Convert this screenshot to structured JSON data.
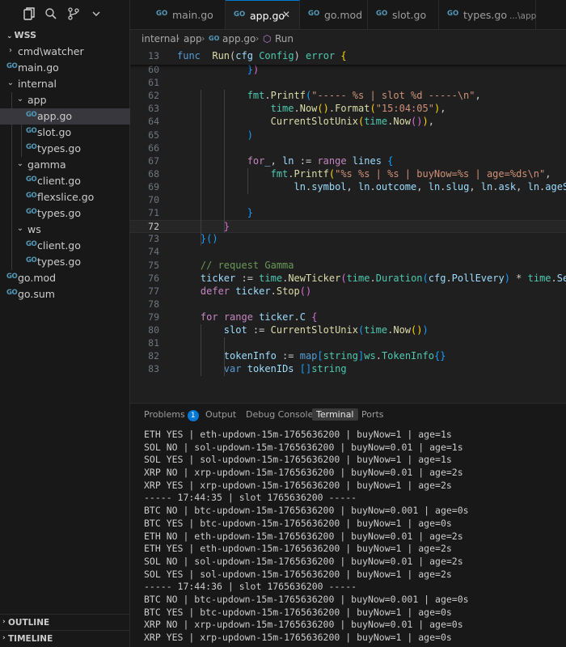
{
  "sidebar": {
    "toolbar_icons": [
      "files-icon",
      "search-icon",
      "source-control-icon",
      "chevron-down-icon"
    ],
    "explorer_title": "WSS",
    "tree": [
      {
        "label": "cmd\\watcher",
        "kind": "folder",
        "depth": 0,
        "expanded": false
      },
      {
        "label": "main.go",
        "kind": "file",
        "depth": 0
      },
      {
        "label": "internal",
        "kind": "folder",
        "depth": 0,
        "expanded": true
      },
      {
        "label": "app",
        "kind": "folder",
        "depth": 1,
        "expanded": true
      },
      {
        "label": "app.go",
        "kind": "file",
        "depth": 2,
        "selected": true
      },
      {
        "label": "slot.go",
        "kind": "file",
        "depth": 2
      },
      {
        "label": "types.go",
        "kind": "file",
        "depth": 2
      },
      {
        "label": "gamma",
        "kind": "folder",
        "depth": 1,
        "expanded": true
      },
      {
        "label": "client.go",
        "kind": "file",
        "depth": 2
      },
      {
        "label": "flexslice.go",
        "kind": "file",
        "depth": 2
      },
      {
        "label": "types.go",
        "kind": "file",
        "depth": 2
      },
      {
        "label": "ws",
        "kind": "folder",
        "depth": 1,
        "expanded": true
      },
      {
        "label": "client.go",
        "kind": "file",
        "depth": 2
      },
      {
        "label": "types.go",
        "kind": "file",
        "depth": 2
      },
      {
        "label": "go.mod",
        "kind": "file",
        "depth": 0
      },
      {
        "label": "go.sum",
        "kind": "file",
        "depth": 0
      }
    ],
    "outline_label": "OUTLINE",
    "timeline_label": "TIMELINE"
  },
  "tabs": [
    {
      "name": "main.go",
      "desc": "",
      "active": false
    },
    {
      "name": "app.go",
      "desc": "",
      "active": true
    },
    {
      "name": "go.mod",
      "desc": "",
      "active": false
    },
    {
      "name": "slot.go",
      "desc": "",
      "active": false
    },
    {
      "name": "types.go",
      "desc": "...\\app",
      "active": false
    }
  ],
  "breadcrumb": {
    "parts": [
      "internal",
      "app",
      "app.go",
      "Run"
    ]
  },
  "editor": {
    "sticky": {
      "line": "13",
      "tokens": [
        [
          "kw",
          "func"
        ],
        [
          "",
          "  "
        ],
        [
          "fn",
          "Run"
        ],
        [
          "",
          "("
        ],
        [
          "vr",
          "cfg"
        ],
        [
          "",
          " "
        ],
        [
          "ty",
          "Config"
        ],
        [
          "",
          ")"
        ],
        [
          "",
          " "
        ],
        [
          "ty",
          "error"
        ],
        [
          "",
          " "
        ],
        [
          "br1",
          "{"
        ]
      ]
    },
    "lines": [
      {
        "n": "60",
        "tokens": [
          [
            "",
            "            "
          ],
          [
            "br3",
            "}"
          ],
          [
            "br2",
            ")"
          ]
        ]
      },
      {
        "n": "61",
        "tokens": []
      },
      {
        "n": "62",
        "tokens": [
          [
            "",
            "            "
          ],
          [
            "ty",
            "fmt"
          ],
          [
            "",
            "."
          ],
          [
            "fn",
            "Printf"
          ],
          [
            "br3",
            "("
          ],
          [
            "str",
            "\"----- %s | slot %d -----\\n\""
          ],
          [
            "",
            ","
          ]
        ]
      },
      {
        "n": "63",
        "tokens": [
          [
            "",
            "                "
          ],
          [
            "ty",
            "time"
          ],
          [
            "",
            "."
          ],
          [
            "fn",
            "Now"
          ],
          [
            "br1",
            "()"
          ],
          [
            "",
            "."
          ],
          [
            "fn",
            "Format"
          ],
          [
            "br1",
            "("
          ],
          [
            "str",
            "\"15:04:05\""
          ],
          [
            "br1",
            ")"
          ],
          [
            "",
            ","
          ]
        ]
      },
      {
        "n": "64",
        "tokens": [
          [
            "",
            "                "
          ],
          [
            "fn",
            "CurrentSlotUnix"
          ],
          [
            "br1",
            "("
          ],
          [
            "ty",
            "time"
          ],
          [
            "",
            "."
          ],
          [
            "fn",
            "Now"
          ],
          [
            "br2",
            "()"
          ],
          [
            "br1",
            ")"
          ],
          [
            "",
            ","
          ]
        ]
      },
      {
        "n": "65",
        "tokens": [
          [
            "",
            "            "
          ],
          [
            "br3",
            ")"
          ]
        ]
      },
      {
        "n": "66",
        "tokens": []
      },
      {
        "n": "67",
        "tokens": [
          [
            "",
            "            "
          ],
          [
            "ctl",
            "for"
          ],
          [
            "",
            "",
            " "
          ],
          [
            "vr",
            "_"
          ],
          [
            "",
            ", "
          ],
          [
            "vr",
            "ln"
          ],
          [
            "",
            " := "
          ],
          [
            "ctl",
            "range"
          ],
          [
            "",
            " "
          ],
          [
            "vr",
            "lines"
          ],
          [
            "",
            " "
          ],
          [
            "br3",
            "{"
          ]
        ]
      },
      {
        "n": "68",
        "tokens": [
          [
            "",
            "                "
          ],
          [
            "ty",
            "fmt"
          ],
          [
            "",
            "."
          ],
          [
            "fn",
            "Printf"
          ],
          [
            "br1",
            "("
          ],
          [
            "str",
            "\"%s %s | %s | buyNow=%s | age=%ds\\n\""
          ],
          [
            "",
            ","
          ]
        ]
      },
      {
        "n": "69",
        "tokens": [
          [
            "",
            "                    "
          ],
          [
            "vr",
            "ln"
          ],
          [
            "",
            "."
          ],
          [
            "vr",
            "symbol"
          ],
          [
            "",
            ", "
          ],
          [
            "vr",
            "ln"
          ],
          [
            "",
            "."
          ],
          [
            "vr",
            "outcome"
          ],
          [
            "",
            ", "
          ],
          [
            "vr",
            "ln"
          ],
          [
            "",
            "."
          ],
          [
            "vr",
            "slug"
          ],
          [
            "",
            ", "
          ],
          [
            "vr",
            "ln"
          ],
          [
            "",
            "."
          ],
          [
            "vr",
            "ask"
          ],
          [
            "",
            ", "
          ],
          [
            "vr",
            "ln"
          ],
          [
            "",
            "."
          ],
          [
            "vr",
            "ageS"
          ],
          [
            "br1",
            ")"
          ]
        ]
      },
      {
        "n": "70",
        "tokens": []
      },
      {
        "n": "71",
        "tokens": [
          [
            "",
            "            "
          ],
          [
            "br3",
            "}"
          ]
        ]
      },
      {
        "n": "72",
        "tokens": [
          [
            "",
            "        "
          ],
          [
            "br2",
            "}"
          ]
        ],
        "current": true
      },
      {
        "n": "73",
        "tokens": [
          [
            "",
            "    "
          ],
          [
            "br3",
            "}"
          ],
          [
            "br3",
            "()"
          ]
        ]
      },
      {
        "n": "74",
        "tokens": []
      },
      {
        "n": "75",
        "tokens": [
          [
            "",
            "    "
          ],
          [
            "cm",
            "// request Gamma"
          ]
        ]
      },
      {
        "n": "76",
        "tokens": [
          [
            "",
            "    "
          ],
          [
            "vr",
            "ticker"
          ],
          [
            "",
            " := "
          ],
          [
            "ty",
            "time"
          ],
          [
            "",
            "."
          ],
          [
            "fn",
            "NewTicker"
          ],
          [
            "br2",
            "("
          ],
          [
            "ty",
            "time"
          ],
          [
            "",
            "."
          ],
          [
            "ty",
            "Duration"
          ],
          [
            "br3",
            "("
          ],
          [
            "vr",
            "cfg"
          ],
          [
            "",
            "."
          ],
          [
            "vr",
            "PollEvery"
          ],
          [
            "br3",
            ")"
          ],
          [
            "",
            " * "
          ],
          [
            "ty",
            "time"
          ],
          [
            "",
            "."
          ],
          [
            "vr",
            "Second"
          ],
          [
            "br2",
            ")"
          ]
        ]
      },
      {
        "n": "77",
        "tokens": [
          [
            "",
            "    "
          ],
          [
            "ctl",
            "defer"
          ],
          [
            "",
            " "
          ],
          [
            "vr",
            "ticker"
          ],
          [
            "",
            "."
          ],
          [
            "fn",
            "Stop"
          ],
          [
            "br2",
            "()"
          ]
        ]
      },
      {
        "n": "78",
        "tokens": []
      },
      {
        "n": "79",
        "tokens": [
          [
            "",
            "    "
          ],
          [
            "ctl",
            "for"
          ],
          [
            "",
            " "
          ],
          [
            "ctl",
            "range"
          ],
          [
            "",
            " "
          ],
          [
            "vr",
            "ticker"
          ],
          [
            "",
            "."
          ],
          [
            "vr",
            "C"
          ],
          [
            "",
            " "
          ],
          [
            "br2",
            "{"
          ]
        ]
      },
      {
        "n": "80",
        "tokens": [
          [
            "",
            "        "
          ],
          [
            "vr",
            "slot"
          ],
          [
            "",
            " := "
          ],
          [
            "fn",
            "CurrentSlotUnix"
          ],
          [
            "br3",
            "("
          ],
          [
            "ty",
            "time"
          ],
          [
            "",
            "."
          ],
          [
            "fn",
            "Now"
          ],
          [
            "br1",
            "()"
          ],
          [
            "br3",
            ")"
          ]
        ]
      },
      {
        "n": "81",
        "tokens": []
      },
      {
        "n": "82",
        "tokens": [
          [
            "",
            "        "
          ],
          [
            "vr",
            "tokenInfo"
          ],
          [
            "",
            " := "
          ],
          [
            "kw",
            "map"
          ],
          [
            "br3",
            "["
          ],
          [
            "ty",
            "string"
          ],
          [
            "br3",
            "]"
          ],
          [
            "ty",
            "ws"
          ],
          [
            "",
            "."
          ],
          [
            "ty",
            "TokenInfo"
          ],
          [
            "br3",
            "{}"
          ]
        ]
      },
      {
        "n": "83",
        "tokens": [
          [
            "",
            "        "
          ],
          [
            "kw",
            "var"
          ],
          [
            "",
            " "
          ],
          [
            "vr",
            "tokenIDs"
          ],
          [
            "",
            " "
          ],
          [
            "br3",
            "[]"
          ],
          [
            "ty",
            "string"
          ]
        ]
      }
    ]
  },
  "panel": {
    "tabs": [
      {
        "label": "Problems",
        "badge": "1",
        "active": false
      },
      {
        "label": "Output",
        "badge": "",
        "active": false
      },
      {
        "label": "Debug Console",
        "badge": "",
        "active": false
      },
      {
        "label": "Terminal",
        "badge": "",
        "active": true
      },
      {
        "label": "Ports",
        "badge": "",
        "active": false
      }
    ],
    "terminal_lines": [
      "ETH YES | eth-updown-15m-1765636200 | buyNow=1 | age=1s",
      "SOL NO | sol-updown-15m-1765636200 | buyNow=0.01 | age=1s",
      "SOL YES | sol-updown-15m-1765636200 | buyNow=1 | age=1s",
      "XRP NO | xrp-updown-15m-1765636200 | buyNow=0.01 | age=2s",
      "XRP YES | xrp-updown-15m-1765636200 | buyNow=1 | age=2s",
      "----- 17:44:35 | slot 1765636200 -----",
      "BTC NO | btc-updown-15m-1765636200 | buyNow=0.001 | age=0s",
      "BTC YES | btc-updown-15m-1765636200 | buyNow=1 | age=0s",
      "ETH NO | eth-updown-15m-1765636200 | buyNow=0.01 | age=2s",
      "ETH YES | eth-updown-15m-1765636200 | buyNow=1 | age=2s",
      "SOL NO | sol-updown-15m-1765636200 | buyNow=0.01 | age=2s",
      "SOL YES | sol-updown-15m-1765636200 | buyNow=1 | age=2s",
      "----- 17:44:36 | slot 1765636200 -----",
      "BTC NO | btc-updown-15m-1765636200 | buyNow=0.001 | age=0s",
      "BTC YES | btc-updown-15m-1765636200 | buyNow=1 | age=0s",
      "XRP NO | xrp-updown-15m-1765636200 | buyNow=0.01 | age=0s",
      "XRP YES | xrp-updown-15m-1765636200 | buyNow=1 | age=0s"
    ]
  },
  "colors": {
    "accent": "#0078d4",
    "go_icon": "#519aba",
    "editor_bg": "#1f1f1f",
    "sidebar_bg": "#181818"
  }
}
